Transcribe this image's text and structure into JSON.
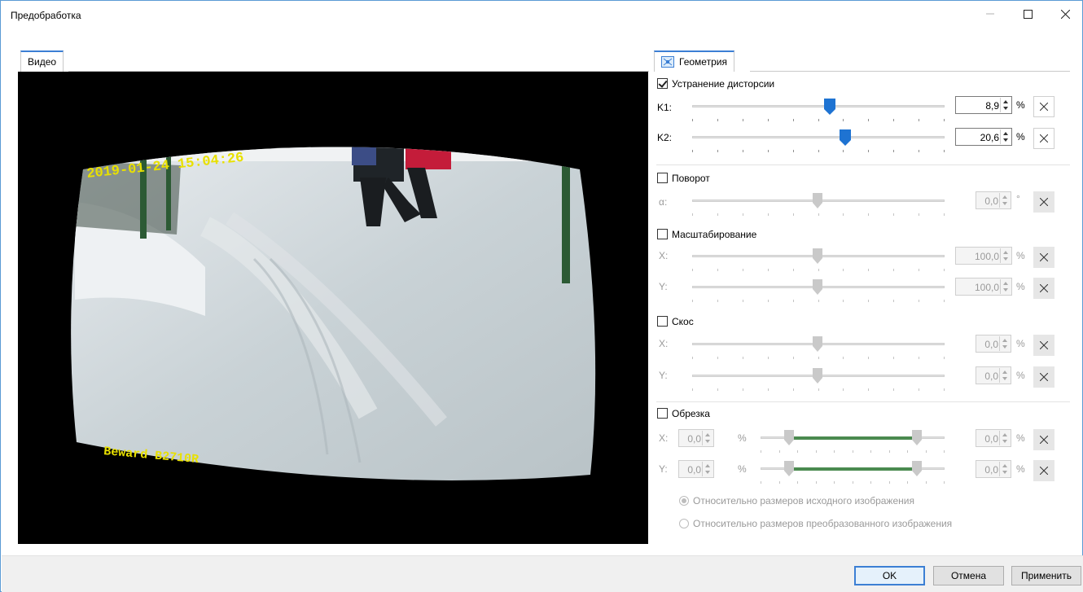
{
  "window": {
    "title": "Предобработка"
  },
  "video_tab": {
    "label": "Видео"
  },
  "video": {
    "timestamp": "2019-01-24 15:04:26",
    "camera_label": "Beward B2710R"
  },
  "geometry_tab": {
    "label": "Геометрия"
  },
  "distortion": {
    "label": "Устранение дисторсии",
    "checked": true,
    "k1": {
      "label": "K1:",
      "value": "8,9",
      "unit": "%",
      "slider_fraction": 0.54
    },
    "k2": {
      "label": "K2:",
      "value": "20,6",
      "unit": "%",
      "slider_fraction": 0.6
    }
  },
  "rotation": {
    "label": "Поворот",
    "checked": false,
    "alpha": {
      "label": "α:",
      "value": "0,0",
      "unit": "°",
      "slider_fraction": 0.5
    }
  },
  "scaling": {
    "label": "Масштабирование",
    "checked": false,
    "x": {
      "label": "X:",
      "value": "100,0",
      "unit": "%",
      "slider_fraction": 0.5
    },
    "y": {
      "label": "Y:",
      "value": "100,0",
      "unit": "%",
      "slider_fraction": 0.5
    }
  },
  "skew": {
    "label": "Скос",
    "checked": false,
    "x": {
      "label": "X:",
      "value": "0,0",
      "unit": "%",
      "slider_fraction": 0.5
    },
    "y": {
      "label": "Y:",
      "value": "0,0",
      "unit": "%",
      "slider_fraction": 0.5
    }
  },
  "crop": {
    "label": "Обрезка",
    "checked": false,
    "x": {
      "label": "X:",
      "left_value": "0,0",
      "right_value": "0,0",
      "unit": "%"
    },
    "y": {
      "label": "Y:",
      "left_value": "0,0",
      "right_value": "0,0",
      "unit": "%"
    },
    "options": [
      {
        "label": "Относительно размеров исходного изображения",
        "selected": true
      },
      {
        "label": "Относительно размеров преобразованного изображения",
        "selected": false
      }
    ]
  },
  "buttons": {
    "ok": "OK",
    "cancel": "Отмена",
    "apply": "Применить"
  },
  "colors": {
    "accent": "#3c7fd4",
    "thumb_active": "#1e73d2",
    "crop_range": "#4a8a4f",
    "timestamp_text": "#e8e000"
  }
}
